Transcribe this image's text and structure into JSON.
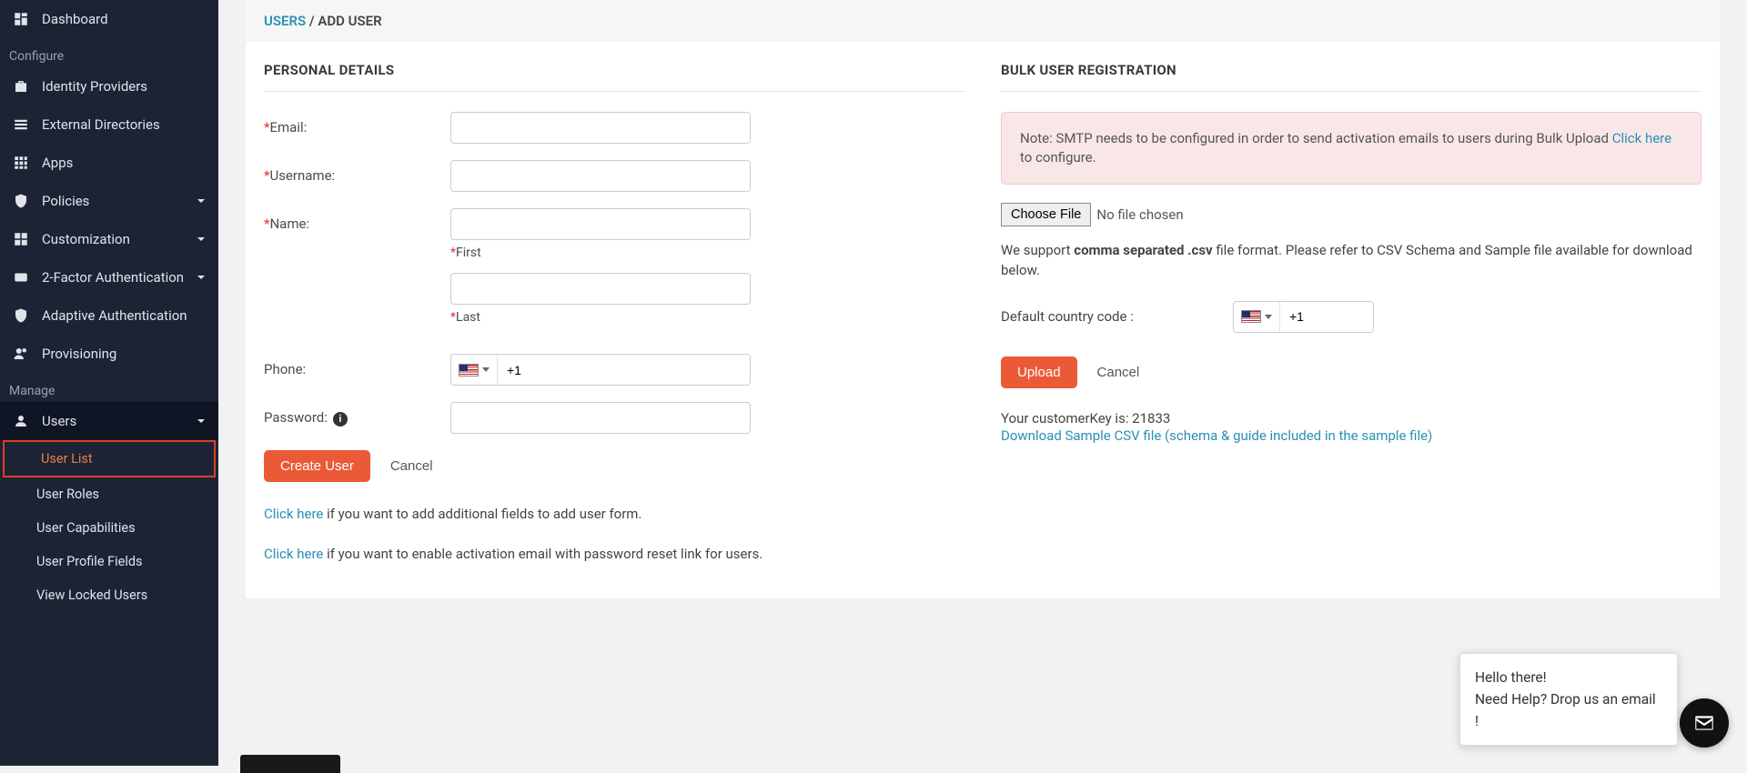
{
  "sidebar": {
    "items": [
      {
        "label": "Dashboard",
        "icon": "dashboard-icon"
      }
    ],
    "configure_label": "Configure",
    "configure_items": [
      {
        "label": "Identity Providers",
        "icon": "briefcase-icon"
      },
      {
        "label": "External Directories",
        "icon": "list-icon"
      },
      {
        "label": "Apps",
        "icon": "grid-icon"
      },
      {
        "label": "Policies",
        "icon": "shield-gear-icon",
        "chev": true
      },
      {
        "label": "Customization",
        "icon": "widgets-icon",
        "chev": true
      },
      {
        "label": "2-Factor Authentication",
        "icon": "numeric-icon",
        "chev": true
      },
      {
        "label": "Adaptive Authentication",
        "icon": "shield-check-icon"
      },
      {
        "label": "Provisioning",
        "icon": "users-sync-icon"
      }
    ],
    "manage_label": "Manage",
    "users_label": "Users",
    "users_icon": "user-icon",
    "users_sub": [
      {
        "label": "User List",
        "active": true
      },
      {
        "label": "User Roles"
      },
      {
        "label": "User Capabilities"
      },
      {
        "label": "User Profile Fields"
      },
      {
        "label": "View Locked Users"
      }
    ]
  },
  "breadcrumb": {
    "parent": "USERS",
    "sep": " / ",
    "current": "ADD USER"
  },
  "personal": {
    "title": "PERSONAL DETAILS",
    "email_label": "Email:",
    "username_label": "Username:",
    "name_label": "Name:",
    "first_label": "First",
    "last_label": "Last",
    "phone_label": "Phone:",
    "phone_prefix": "+1",
    "password_label": "Password:",
    "create_btn": "Create User",
    "cancel_btn": "Cancel",
    "hint1_link": "Click here",
    "hint1_rest": " if you want to add additional fields to add user form.",
    "hint2_link": "Click here",
    "hint2_rest": " if you want to enable activation email with password reset link for users."
  },
  "bulk": {
    "title": "BULK USER REGISTRATION",
    "alert_pre": "Note: SMTP needs to be configured in order to send activation emails to users during Bulk Upload ",
    "alert_link": "Click here",
    "alert_post": " to configure.",
    "choose_file": "Choose File",
    "no_file": "No file chosen",
    "support_pre": "We support ",
    "support_bold": "comma separated .csv",
    "support_post": " file format. Please refer to CSV Schema and Sample file available for download below.",
    "cc_label": "Default country code :",
    "cc_value": "+1",
    "upload_btn": "Upload",
    "cancel_btn": "Cancel",
    "ck_label": "Your customerKey is: ",
    "ck_value": "21833",
    "dl_link": "Download Sample CSV file (schema & guide included in the sample file)"
  },
  "chat": {
    "line1": "Hello there!",
    "line2": "Need Help? Drop us an email !"
  }
}
